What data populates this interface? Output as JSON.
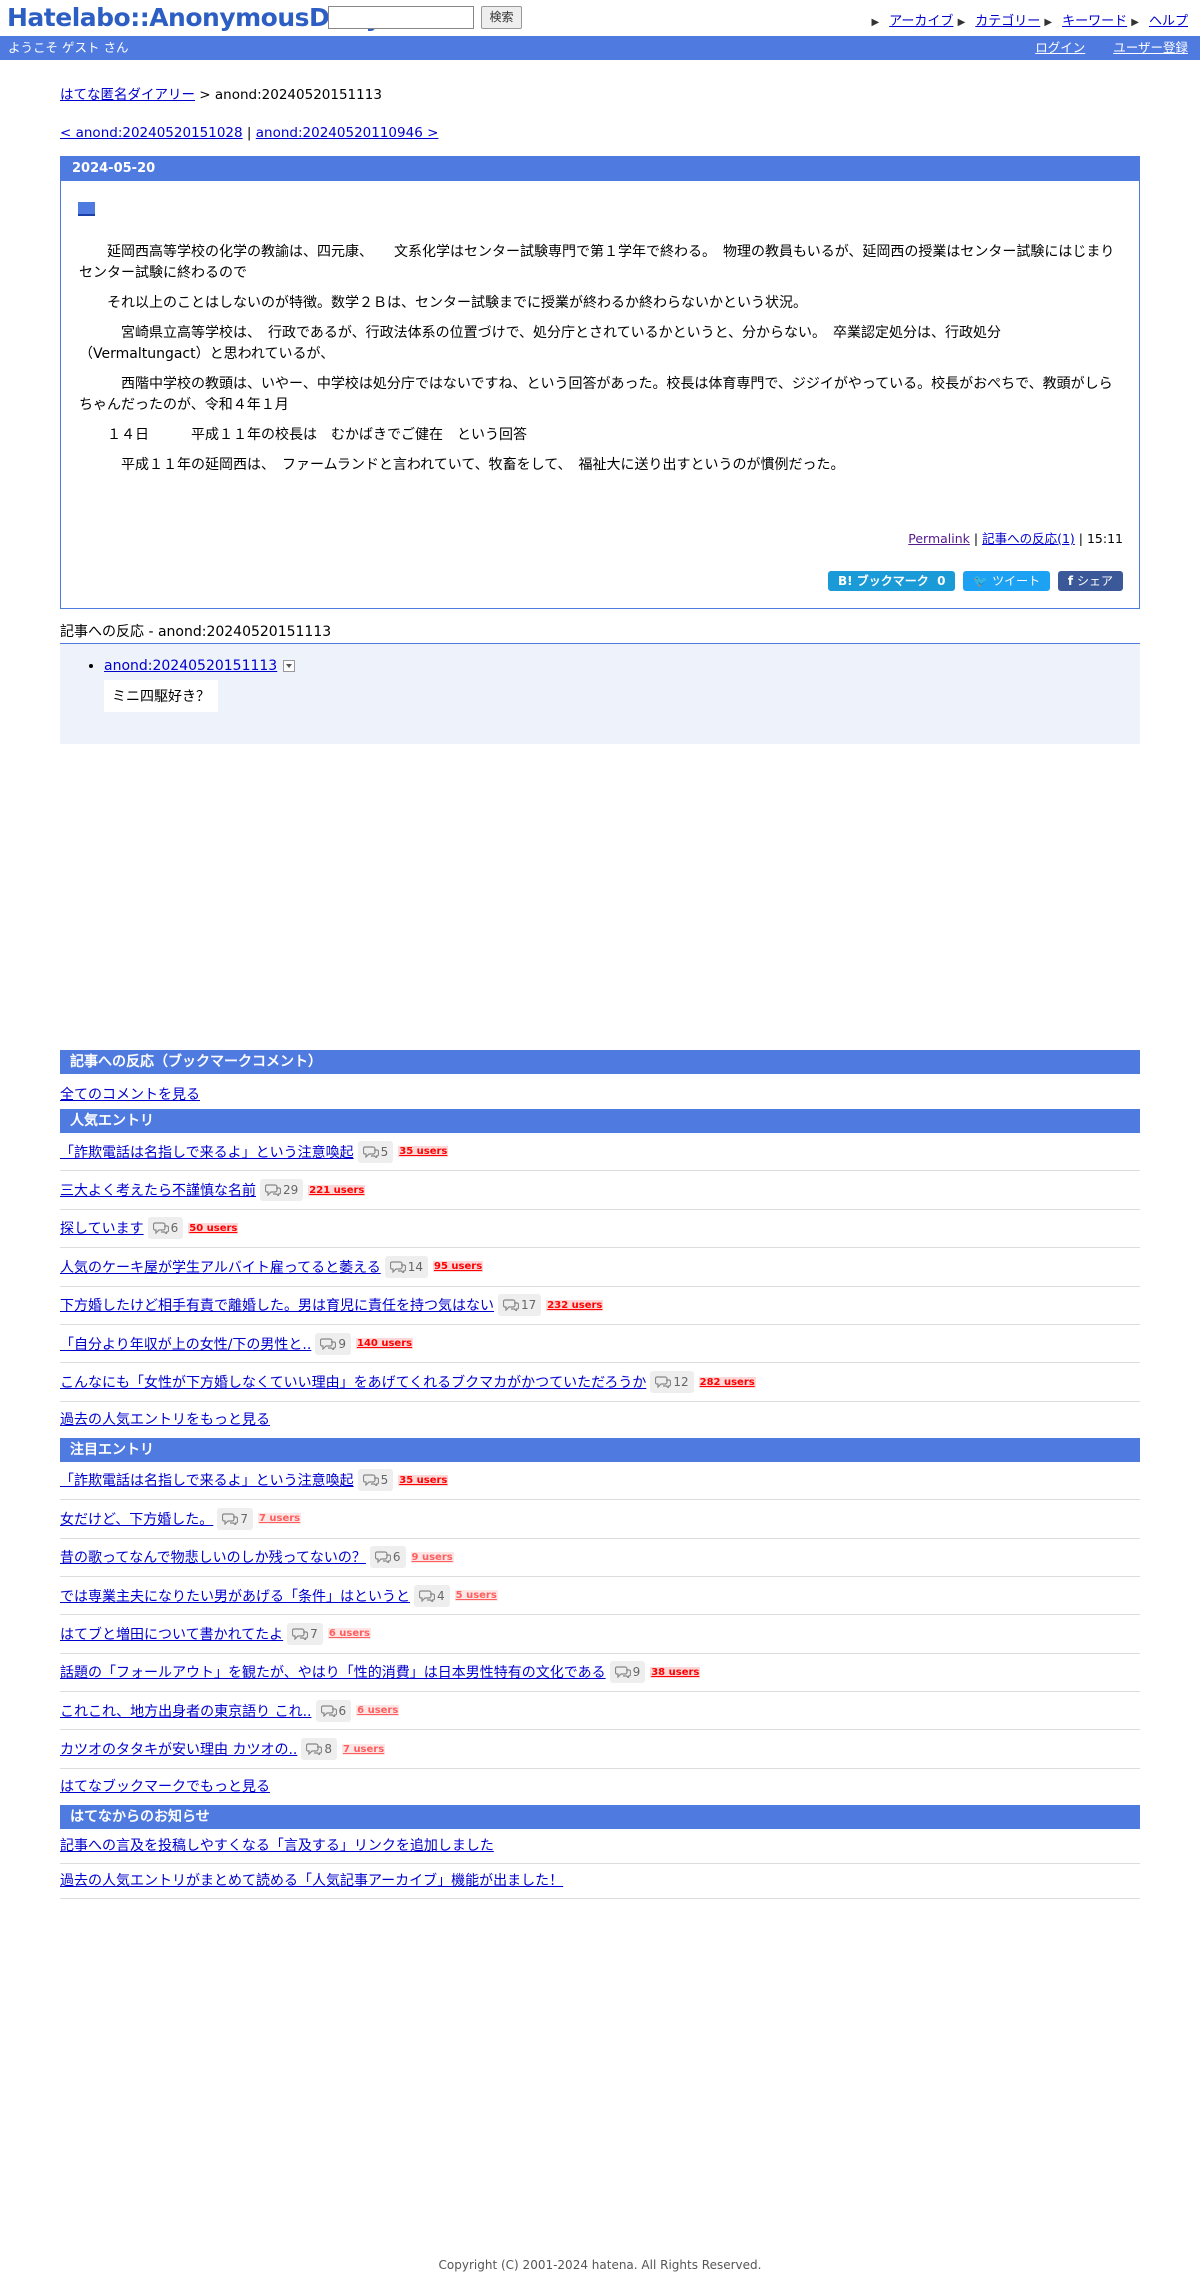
{
  "header": {
    "logo": "Hatelabo::AnonymousDiary",
    "search_button": "検索",
    "links": [
      "アーカイブ",
      "カテゴリー",
      "キーワード",
      "ヘルプ"
    ]
  },
  "welcome_bar": {
    "greeting": "ようこそ ゲスト さん",
    "login": "ログイン",
    "register": "ユーザー登録"
  },
  "breadcrumb": {
    "home": "はてな匿名ダイアリー",
    "separator": ">",
    "current": "anond:20240520151113"
  },
  "nav": {
    "prev": "< anond:20240520151028",
    "sep": "|",
    "next": "anond:20240520110946 >"
  },
  "entry": {
    "date": "2024-05-20",
    "section_link": "■",
    "paragraphs": [
      "　　延岡西高等学校の化学の教諭は、四元康、　　文系化学はセンター試験専門で第１学年で終わる。　物理の教員もいるが、延岡西の授業はセンター試験にはじまりセンター試験に終わるので",
      "　　それ以上のことはしないのが特徴。数学２Ｂは、センター試験までに授業が終わるか終わらないかという状況。",
      "　　　宮崎県立高等学校は、　行政であるが、行政法体系の位置づけで、処分庁とされているかというと、分からない。　卒業認定処分は、行政処分（Vermaltungact）と思われているが、",
      "　　　西階中学校の教頭は、いやー、中学校は処分庁ではないですね、という回答があった。校長は体育専門で、ジジイがやっている。校長がおぺちで、教頭がしらちゃんだったのが、令和４年１月",
      "　　１４日　　　平成１１年の校長は　むかばきでご健在　という回答",
      "　　　平成１１年の延岡西は、　ファームランドと言われていて、牧畜をして、　福祉大に送り出すというのが慣例だった。"
    ],
    "permalink": "Permalink",
    "reactions_link": "記事への反応(1)",
    "time": "15:11",
    "share": {
      "bookmark": "B! ブックマーク",
      "bookmark_count": "0",
      "tweet": "ツイート",
      "share": "シェア"
    }
  },
  "reactions": {
    "title": "記事への反応 - anond:20240520151113",
    "items": [
      {
        "link": "anond:20240520151113",
        "text": "ミニ四駆好き？"
      }
    ]
  },
  "bookmark_comments": {
    "title": "記事への反応（ブックマークコメント）",
    "all_link": "全てのコメントを見る"
  },
  "popular": {
    "title": "人気エントリ",
    "entries": [
      {
        "title": "「詐欺電話は名指しで来るよ」という注意喚起",
        "comments": "5",
        "users": "35 users",
        "hot": true
      },
      {
        "title": "三大よく考えたら不謹慎な名前",
        "comments": "29",
        "users": "221 users",
        "hot": true
      },
      {
        "title": "探しています",
        "comments": "6",
        "users": "50 users",
        "hot": true
      },
      {
        "title": "人気のケーキ屋が学生アルバイト雇ってると萎える",
        "comments": "14",
        "users": "95 users",
        "hot": true
      },
      {
        "title": "下方婚したけど相手有責で離婚した。男は育児に責任を持つ気はない",
        "comments": "17",
        "users": "232 users",
        "hot": true
      },
      {
        "title": "「自分より年収が上の女性/下の男性と..",
        "comments": "9",
        "users": "140 users",
        "hot": true
      },
      {
        "title": "こんなにも「女性が下方婚しなくていい理由」をあげてくれるブクマカがかつていただろうか",
        "comments": "12",
        "users": "282 users",
        "hot": true
      }
    ],
    "more": "過去の人気エントリをもっと見る"
  },
  "attention": {
    "title": "注目エントリ",
    "entries": [
      {
        "title": "「詐欺電話は名指しで来るよ」という注意喚起",
        "comments": "5",
        "users": "35 users",
        "hot": true
      },
      {
        "title": "女だけど、下方婚した。",
        "comments": "7",
        "users": "7 users",
        "hot": false
      },
      {
        "title": "昔の歌ってなんで物悲しいのしか残ってないの？",
        "comments": "6",
        "users": "9 users",
        "hot": false
      },
      {
        "title": "では専業主夫になりたい男があげる「条件」はというと",
        "comments": "4",
        "users": "5 users",
        "hot": false
      },
      {
        "title": "はてブと増田について書かれてたよ",
        "comments": "7",
        "users": "6 users",
        "hot": false
      },
      {
        "title": "話題の「フォールアウト」を観たが、やはり「性的消費」は日本男性特有の文化である",
        "comments": "9",
        "users": "38 users",
        "hot": true
      },
      {
        "title": "これこれ、地方出身者の東京語り これ..",
        "comments": "6",
        "users": "6 users",
        "hot": false
      },
      {
        "title": "カツオのタタキが安い理由 カツオの..",
        "comments": "8",
        "users": "7 users",
        "hot": false
      }
    ],
    "more": "はてなブックマークでもっと見る"
  },
  "notices": {
    "title": "はてなからのお知らせ",
    "items": [
      "記事への言及を投稿しやすくなる「言及する」リンクを追加しました",
      "過去の人気エントリがまとめて読める「人気記事アーカイブ」機能が出ました！"
    ]
  },
  "footer": {
    "copyright": "Copyright (C) 2001-2024 hatena. All Rights Reserved."
  },
  "colors": {
    "accent": "#4f7ae0",
    "hot_users": "#ff0000"
  }
}
